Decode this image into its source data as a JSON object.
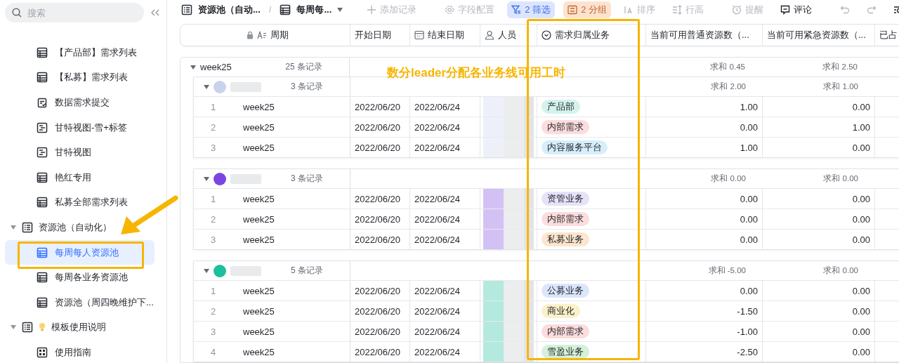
{
  "sidebar": {
    "search": {
      "placeholder": "搜索"
    },
    "items": [
      {
        "label": "【产品部】需求列表",
        "kind": "table",
        "selected": false
      },
      {
        "label": "【私募】需求列表",
        "kind": "table",
        "selected": false
      },
      {
        "label": "数据需求提交",
        "kind": "form",
        "selected": false
      },
      {
        "label": "甘特视图-雪+标签",
        "kind": "gantt",
        "selected": false
      },
      {
        "label": "甘特视图",
        "kind": "gantt",
        "selected": false
      },
      {
        "label": "艳红专用",
        "kind": "table",
        "selected": false
      },
      {
        "label": "私募全部需求列表",
        "kind": "table",
        "selected": false
      },
      {
        "label": "资源池（自动化）",
        "kind": "folder",
        "selected": false,
        "expanded": true,
        "children": [
          {
            "label": "每周每人资源池",
            "kind": "table",
            "selected": true
          },
          {
            "label": "每周各业务资源池",
            "kind": "table",
            "selected": false
          },
          {
            "label": "资源池（周四晚维护下...",
            "kind": "table",
            "selected": false
          }
        ]
      },
      {
        "label": "模板使用说明",
        "kind": "folder_bulb",
        "selected": false,
        "expanded": true,
        "children": [
          {
            "label": "使用指南",
            "kind": "grid",
            "selected": false
          }
        ]
      }
    ]
  },
  "toolbar": {
    "breadcrumb": [
      {
        "label": "资源池（自动...",
        "kind": "folder"
      },
      {
        "label": "每周每...",
        "kind": "table"
      }
    ],
    "separator": "/",
    "groups": [
      [
        {
          "label": "添加记录",
          "kind": "add",
          "disabled": true
        }
      ],
      [
        {
          "label": "字段配置",
          "kind": "gear",
          "disabled": true
        },
        {
          "label": "2 筛选",
          "kind": "filter",
          "disabled": false
        },
        {
          "label": "2 分组",
          "kind": "group",
          "disabled": false
        },
        {
          "label": "排序",
          "kind": "sort",
          "disabled": true
        },
        {
          "label": "行高",
          "kind": "height",
          "disabled": true
        }
      ],
      [
        {
          "label": "提醒",
          "kind": "alarm",
          "disabled": true
        },
        {
          "label": "评论",
          "kind": "comment",
          "disabled": false
        }
      ],
      [
        {
          "kind": "undo",
          "disabled": true
        },
        {
          "kind": "redo",
          "disabled": true
        },
        {
          "kind": "find",
          "disabled": false
        }
      ]
    ]
  },
  "table": {
    "columns": [
      {
        "label": "周期",
        "kind": "primary"
      },
      {
        "label": "开始日期",
        "kind": "plain"
      },
      {
        "label": "结束日期",
        "kind": "date"
      },
      {
        "label": "人员",
        "kind": "person"
      },
      {
        "label": "需求归属业务",
        "kind": "select"
      },
      {
        "label": "当前可用普通资源数（...",
        "kind": "plain"
      },
      {
        "label": "当前可用紧急资源数（...",
        "kind": "plain"
      },
      {
        "label": "已占",
        "kind": "plain"
      }
    ],
    "groups": [
      {
        "label": "week25",
        "count": "25 条记录",
        "sums": [
          "求和 0.45",
          "求和 2.50"
        ],
        "subgroups": [
          {
            "color": "#c9d3ee",
            "count": "3 条记录",
            "sums": [
              "求和 2.00",
              "求和 1.00"
            ],
            "rows": [
              {
                "index": "1",
                "period": "week25",
                "start": "2022/06/20",
                "end": "2022/06/24",
                "tag": {
                  "label": "产品部",
                  "color": "#d3f3ec"
                },
                "normal": "1.00",
                "urgent": "0.00"
              },
              {
                "index": "2",
                "period": "week25",
                "start": "2022/06/20",
                "end": "2022/06/24",
                "tag": {
                  "label": "内部需求",
                  "color": "#fcdcdc"
                },
                "normal": "0.00",
                "urgent": "1.00"
              },
              {
                "index": "3",
                "period": "week25",
                "start": "2022/06/20",
                "end": "2022/06/24",
                "tag": {
                  "label": "内容服务平台",
                  "color": "#d6eefb"
                },
                "normal": "1.00",
                "urgent": "0.00"
              }
            ]
          },
          {
            "color": "#7b46e0",
            "count": "3 条记录",
            "sums": [
              "求和 0.00",
              "求和 0.00"
            ],
            "rows": [
              {
                "index": "1",
                "period": "week25",
                "start": "2022/06/20",
                "end": "2022/06/24",
                "tag": {
                  "label": "资管业务",
                  "color": "#e7e1f9"
                },
                "normal": "0.00",
                "urgent": "0.00"
              },
              {
                "index": "2",
                "period": "week25",
                "start": "2022/06/20",
                "end": "2022/06/24",
                "tag": {
                  "label": "内部需求",
                  "color": "#fcdcdc"
                },
                "normal": "0.00",
                "urgent": "0.00"
              },
              {
                "index": "3",
                "period": "week25",
                "start": "2022/06/20",
                "end": "2022/06/24",
                "tag": {
                  "label": "私募业务",
                  "color": "#fde6cd"
                },
                "normal": "0.00",
                "urgent": "0.00"
              }
            ]
          },
          {
            "color": "#1dbf9c",
            "count": "5 条记录",
            "sums": [
              "求和 -5.00",
              "求和 0.00"
            ],
            "rows": [
              {
                "index": "1",
                "period": "week25",
                "start": "2022/06/20",
                "end": "2022/06/24",
                "tag": {
                  "label": "公募业务",
                  "color": "#dbe6fc"
                },
                "normal": "0.00",
                "urgent": "0.00"
              },
              {
                "index": "2",
                "period": "week25",
                "start": "2022/06/20",
                "end": "2022/06/24",
                "tag": {
                  "label": "商业化",
                  "color": "#fbf1c9"
                },
                "normal": "-1.50",
                "urgent": "0.00"
              },
              {
                "index": "3",
                "period": "week25",
                "start": "2022/06/20",
                "end": "2022/06/24",
                "tag": {
                  "label": "内部需求",
                  "color": "#fcdcdc"
                },
                "normal": "-1.00",
                "urgent": "0.00"
              },
              {
                "index": "4",
                "period": "week25",
                "start": "2022/06/20",
                "end": "2022/06/24",
                "tag": {
                  "label": "雪盈业务",
                  "color": "#d5f1d8"
                },
                "normal": "-2.50",
                "urgent": "0.00"
              }
            ]
          }
        ]
      }
    ]
  },
  "annotation": {
    "text": "数分leader分配各业务线可用工时"
  }
}
